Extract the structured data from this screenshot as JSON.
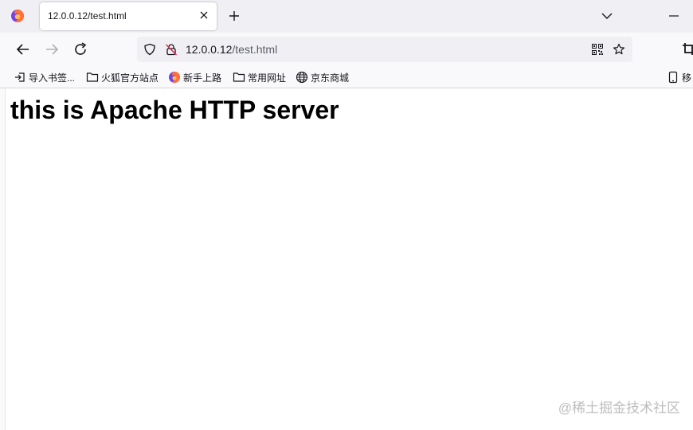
{
  "window": {
    "tab_title": "12.0.0.12/test.html"
  },
  "urlbar": {
    "host": "12.0.0.12",
    "path": "/test.html"
  },
  "bookmarks": [
    {
      "label": "导入书签...",
      "icon": "import-icon"
    },
    {
      "label": "火狐官方站点",
      "icon": "folder-icon"
    },
    {
      "label": "新手上路",
      "icon": "firefox-icon"
    },
    {
      "label": "常用网址",
      "icon": "folder-icon"
    },
    {
      "label": "京东商城",
      "icon": "globe-icon"
    },
    {
      "label": "移",
      "icon": "mobile-icon"
    }
  ],
  "page": {
    "heading": "this is Apache HTTP server",
    "watermark": "@稀土掘金技术社区"
  },
  "colors": {
    "firefox_orange": "#ff7139",
    "firefox_purple": "#7542e5",
    "tab_strip_bg": "#f0f0f4",
    "toolbar_bg": "#f9f9fb"
  }
}
